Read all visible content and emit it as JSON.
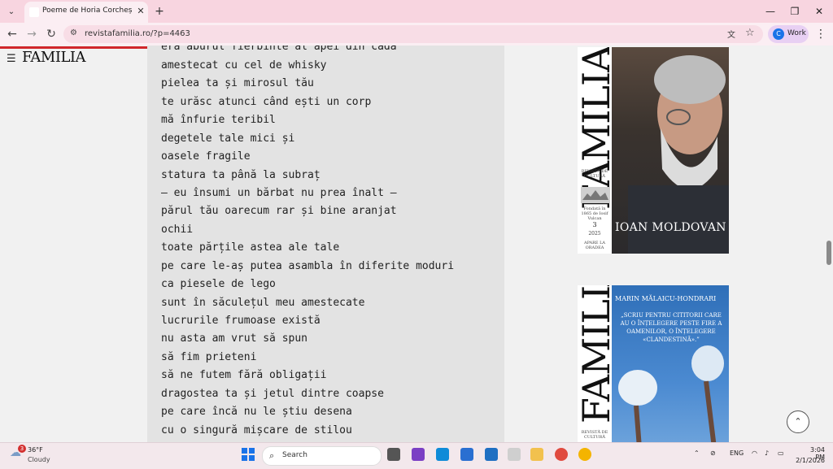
{
  "browser": {
    "tab_title": "Poeme de Horia Corcheș – Revi",
    "url": "revistafamilia.ro/?p=4463",
    "profile_initial": "C",
    "profile_name": "Work"
  },
  "site": {
    "logo": "FAMILIA"
  },
  "poem": {
    "lines": [
      "era aburul fierbinte al apei din cadă",
      "amestecat cu cel de whisky",
      "pielea ta și mirosul tău",
      "te urăsc atunci când ești un corp",
      "mă înfurie teribil",
      "degetele tale mici și",
      "oasele fragile",
      "statura ta până la subraț",
      "– eu însumi un bărbat nu prea înalt –",
      "părul tău oarecum rar și bine aranjat",
      "ochii",
      "toate părțile astea ale tale",
      "pe care le-aș putea asambla în diferite moduri",
      "ca piesele de lego",
      "sunt în săculețul meu amestecate",
      "lucrurile frumoase există",
      "nu asta am vrut să spun",
      "să fim prieteni",
      "să ne futem fără obligații",
      "dragostea ta și jetul dintre coapse",
      "pe care încă nu le știu desena",
      "cu o singură mișcare de stilou"
    ]
  },
  "covers": {
    "cover1": {
      "title": "FAMILIA",
      "subtitle": "REVISTĂ DE CULTURĂ",
      "founded": "Fondată în 1865 de Iosif Vulcan",
      "number": "3",
      "year": "2025",
      "city": "APARE LA ORADEA",
      "name": "IOAN MOLDOVAN"
    },
    "cover2": {
      "title": "FAMILIA",
      "subtitle": "REVISTĂ DE CULTURĂ",
      "author": "MARIN MĂLAICU-HONDRARI",
      "quote": "„SCRIU PENTRU CITITORII CARE AU O ÎNȚELEGERE PESTE FIRE A OAMENILOR, O ÎNȚELEGERE «CLANDESTINĂ».”"
    }
  },
  "taskbar": {
    "weather_temp": "36°F",
    "weather_desc": "Cloudy",
    "weather_badge": "3",
    "search_placeholder": "Search",
    "lang": "ENG",
    "time": "3:04 PM",
    "date": "2/1/2026"
  },
  "colors": {
    "tab_bar": "#f8d5e0",
    "progress": "#d1262b",
    "poem_bg": "#e3e3e3"
  }
}
